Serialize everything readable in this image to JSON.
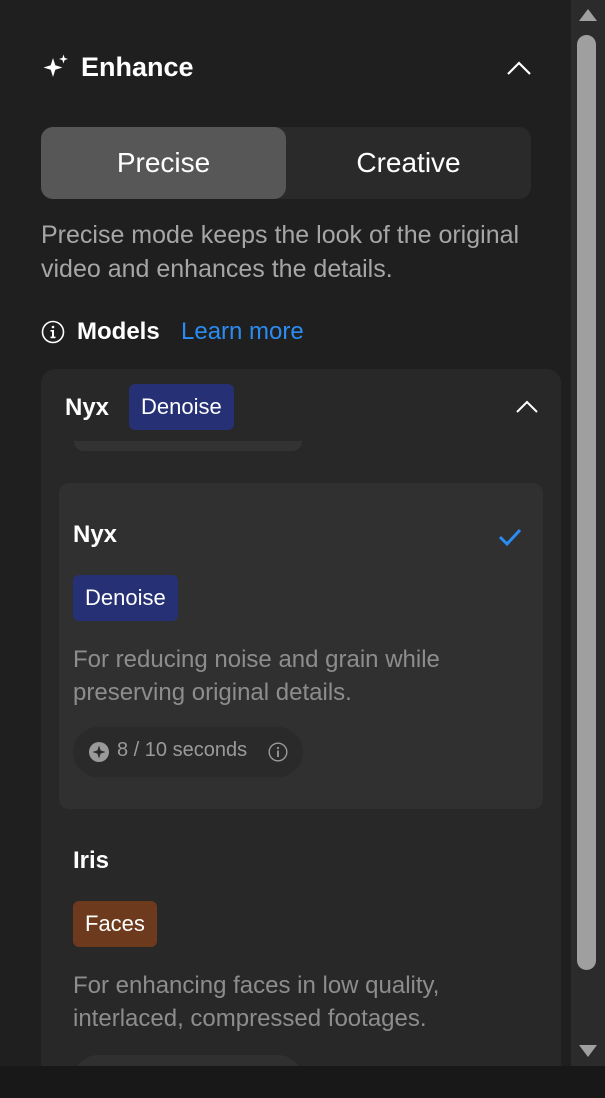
{
  "enhance": {
    "title": "Enhance",
    "icon": "sparkle-icon",
    "collapse_icon": "chevron-up-icon"
  },
  "mode_toggle": {
    "options": [
      "Precise",
      "Creative"
    ],
    "selected": "Precise",
    "description": "Precise mode keeps the look of the original video and enhances the details."
  },
  "models": {
    "label": "Models",
    "learn_more": "Learn more",
    "selected_model": {
      "name": "Nyx",
      "tag": "Denoise"
    },
    "options": [
      {
        "name": "Nyx",
        "tag": "Denoise",
        "tag_color": "#263075",
        "description": "For reducing noise and grain while preserving original details.",
        "cost": "8 / 10 seconds",
        "selected": true
      },
      {
        "name": "Iris",
        "tag": "Faces",
        "tag_color": "#6e3a1d",
        "description": "For enhancing faces in low quality, interlaced, compressed footages.",
        "selected": false
      }
    ]
  },
  "colors": {
    "background": "#1f1f1f",
    "accent": "#2a8cf2",
    "selected_segment": "#575757"
  }
}
